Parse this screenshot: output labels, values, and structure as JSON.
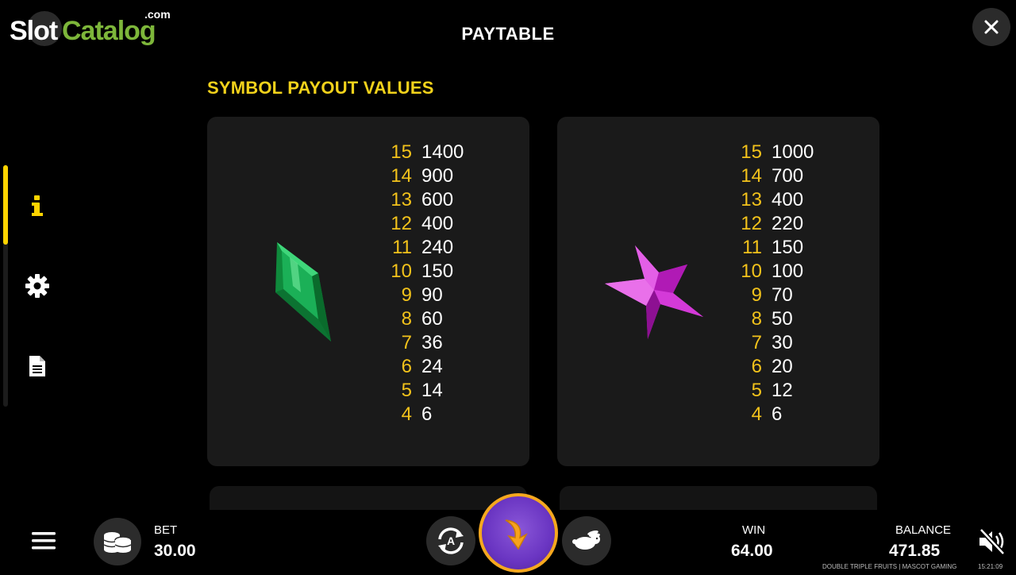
{
  "watermark": {
    "slot": "Slot",
    "catalog": "Catalog",
    "domain": ".com"
  },
  "header": {
    "title": "PAYTABLE"
  },
  "section": {
    "title": "SYMBOL PAYOUT VALUES"
  },
  "side_nav": {
    "items": [
      {
        "icon": "info-icon",
        "active": true
      },
      {
        "icon": "gear-icon",
        "active": false
      },
      {
        "icon": "document-icon",
        "active": false
      }
    ]
  },
  "paytables": [
    {
      "symbol": "green-emerald-icon",
      "rows": [
        {
          "count": "15",
          "value": "1400"
        },
        {
          "count": "14",
          "value": "900"
        },
        {
          "count": "13",
          "value": "600"
        },
        {
          "count": "12",
          "value": "400"
        },
        {
          "count": "11",
          "value": "240"
        },
        {
          "count": "10",
          "value": "150"
        },
        {
          "count": "9",
          "value": "90"
        },
        {
          "count": "8",
          "value": "60"
        },
        {
          "count": "7",
          "value": "36"
        },
        {
          "count": "6",
          "value": "24"
        },
        {
          "count": "5",
          "value": "14"
        },
        {
          "count": "4",
          "value": "6"
        }
      ]
    },
    {
      "symbol": "pink-star-icon",
      "rows": [
        {
          "count": "15",
          "value": "1000"
        },
        {
          "count": "14",
          "value": "700"
        },
        {
          "count": "13",
          "value": "400"
        },
        {
          "count": "12",
          "value": "220"
        },
        {
          "count": "11",
          "value": "150"
        },
        {
          "count": "10",
          "value": "100"
        },
        {
          "count": "9",
          "value": "70"
        },
        {
          "count": "8",
          "value": "50"
        },
        {
          "count": "7",
          "value": "30"
        },
        {
          "count": "6",
          "value": "20"
        },
        {
          "count": "5",
          "value": "12"
        },
        {
          "count": "4",
          "value": "6"
        }
      ]
    }
  ],
  "bottom_bar": {
    "bet_label": "BET",
    "bet_value": "30.00",
    "win_label": "WIN",
    "win_value": "64.00",
    "balance_label": "BALANCE",
    "balance_value": "471.85",
    "credit": "DOUBLE TRIPLE FRUITS | MASCOT GAMING",
    "time": "15:21:09",
    "autoplay_letter": "A"
  },
  "colors": {
    "accent_yellow": "#f2d21b",
    "count_orange": "#f2c21b",
    "spin_purple": "#6a35c2",
    "spin_ring": "#f6a81e",
    "logo_green": "#7db63a"
  }
}
